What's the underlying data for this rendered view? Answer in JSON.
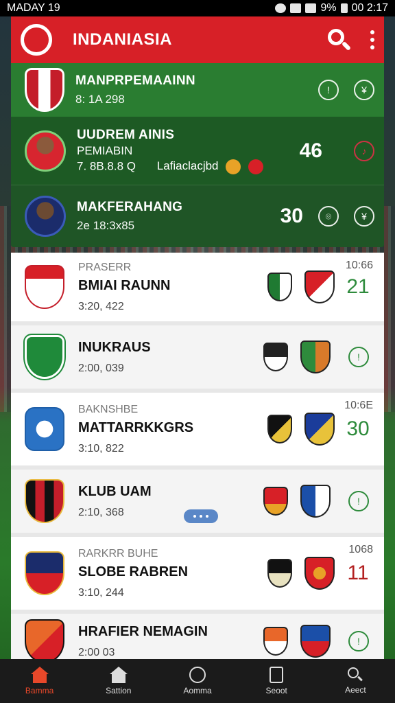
{
  "status_bar": {
    "left": "MADAY 19",
    "battery": "9%",
    "time": "00 2:17"
  },
  "app": {
    "title": "INDANIASIA"
  },
  "featured": [
    {
      "title": "MANPRPEMAAINN",
      "sub": "8: 1A 298"
    },
    {
      "title": "UUDREM AINIS",
      "title2": "PEMIABIN",
      "sub": "7. 8B.8.8 Q",
      "extra": "Lafiaclacjbd",
      "score": "46"
    },
    {
      "title": "MAKFERAHANG",
      "sub": "2e 18:3x85",
      "score": "30"
    }
  ],
  "matches": [
    {
      "label": "PRASERR",
      "title": "BMIAI RAUNN",
      "sub": "3:20, 422",
      "time": "10:66",
      "score": "21"
    },
    {
      "label": "",
      "title": "INUKRAUS",
      "sub": "2:00, 039",
      "time": "",
      "score": ""
    },
    {
      "label": "BAKNSHBE",
      "title": "MATTARRKKGRS",
      "sub": "3:10, 822",
      "time": "10:6E",
      "score": "30"
    },
    {
      "label": "",
      "title": "KLUB UAM",
      "sub": "2:10, 368",
      "time": "",
      "score": ""
    },
    {
      "label": "RARKRR BUHE",
      "title": "SLOBE RABREN",
      "sub": "3:10, 244",
      "time": "1068",
      "score": "11"
    },
    {
      "label": "",
      "title": "HRAFIER NEMAGIN",
      "sub": "2:00 03",
      "time": "",
      "score": ""
    }
  ],
  "nav": [
    {
      "label": "Bamma"
    },
    {
      "label": "Sattion"
    },
    {
      "label": "Aomma"
    },
    {
      "label": "Seoot"
    },
    {
      "label": "Aeect"
    }
  ],
  "colors": {
    "brand_red": "#d72027",
    "green_dark": "#215828",
    "score_green": "#2e8b3c",
    "score_red": "#b32020",
    "nav_active": "#e8482a"
  }
}
